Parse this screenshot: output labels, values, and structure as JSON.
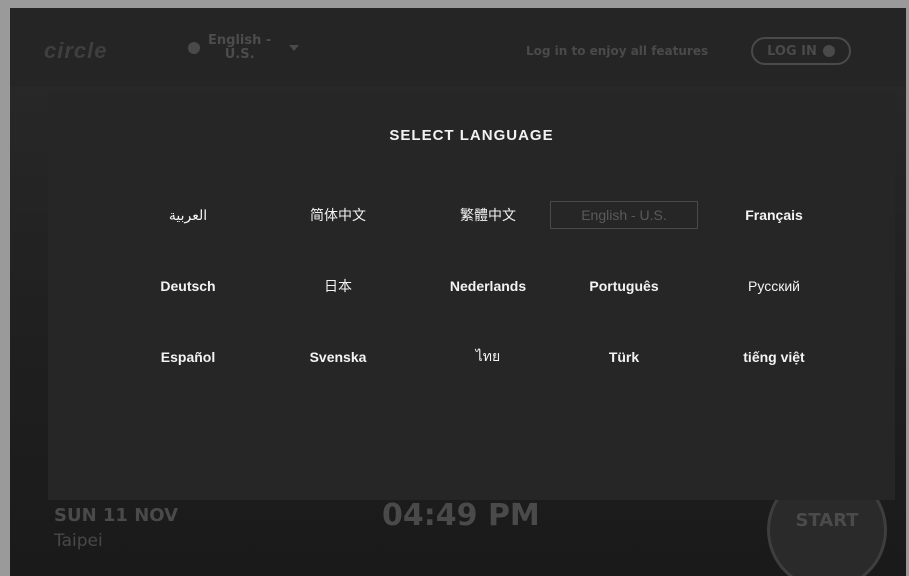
{
  "topbar": {
    "logo": "circle",
    "current_language": "English -\nU.S.",
    "login_hint": "Log in to enjoy all features",
    "login_button": "LOG IN"
  },
  "home": {
    "date": "SUN 11 NOV",
    "city": "Taipei",
    "time": "04:49 PM",
    "start_button": "START"
  },
  "modal": {
    "title": "SELECT LANGUAGE",
    "languages": [
      {
        "label": "العربية"
      },
      {
        "label": "简体中文"
      },
      {
        "label": "繁體中文"
      },
      {
        "label": "English - U.S.",
        "selected": true
      },
      {
        "label": "Français"
      },
      {
        "label": "Deutsch"
      },
      {
        "label": "日本"
      },
      {
        "label": "Nederlands"
      },
      {
        "label": "Português"
      },
      {
        "label": "Русский"
      },
      {
        "label": "Español"
      },
      {
        "label": "Svenska"
      },
      {
        "label": "ไทย"
      },
      {
        "label": "Türk"
      },
      {
        "label": "tiếng việt"
      }
    ]
  }
}
